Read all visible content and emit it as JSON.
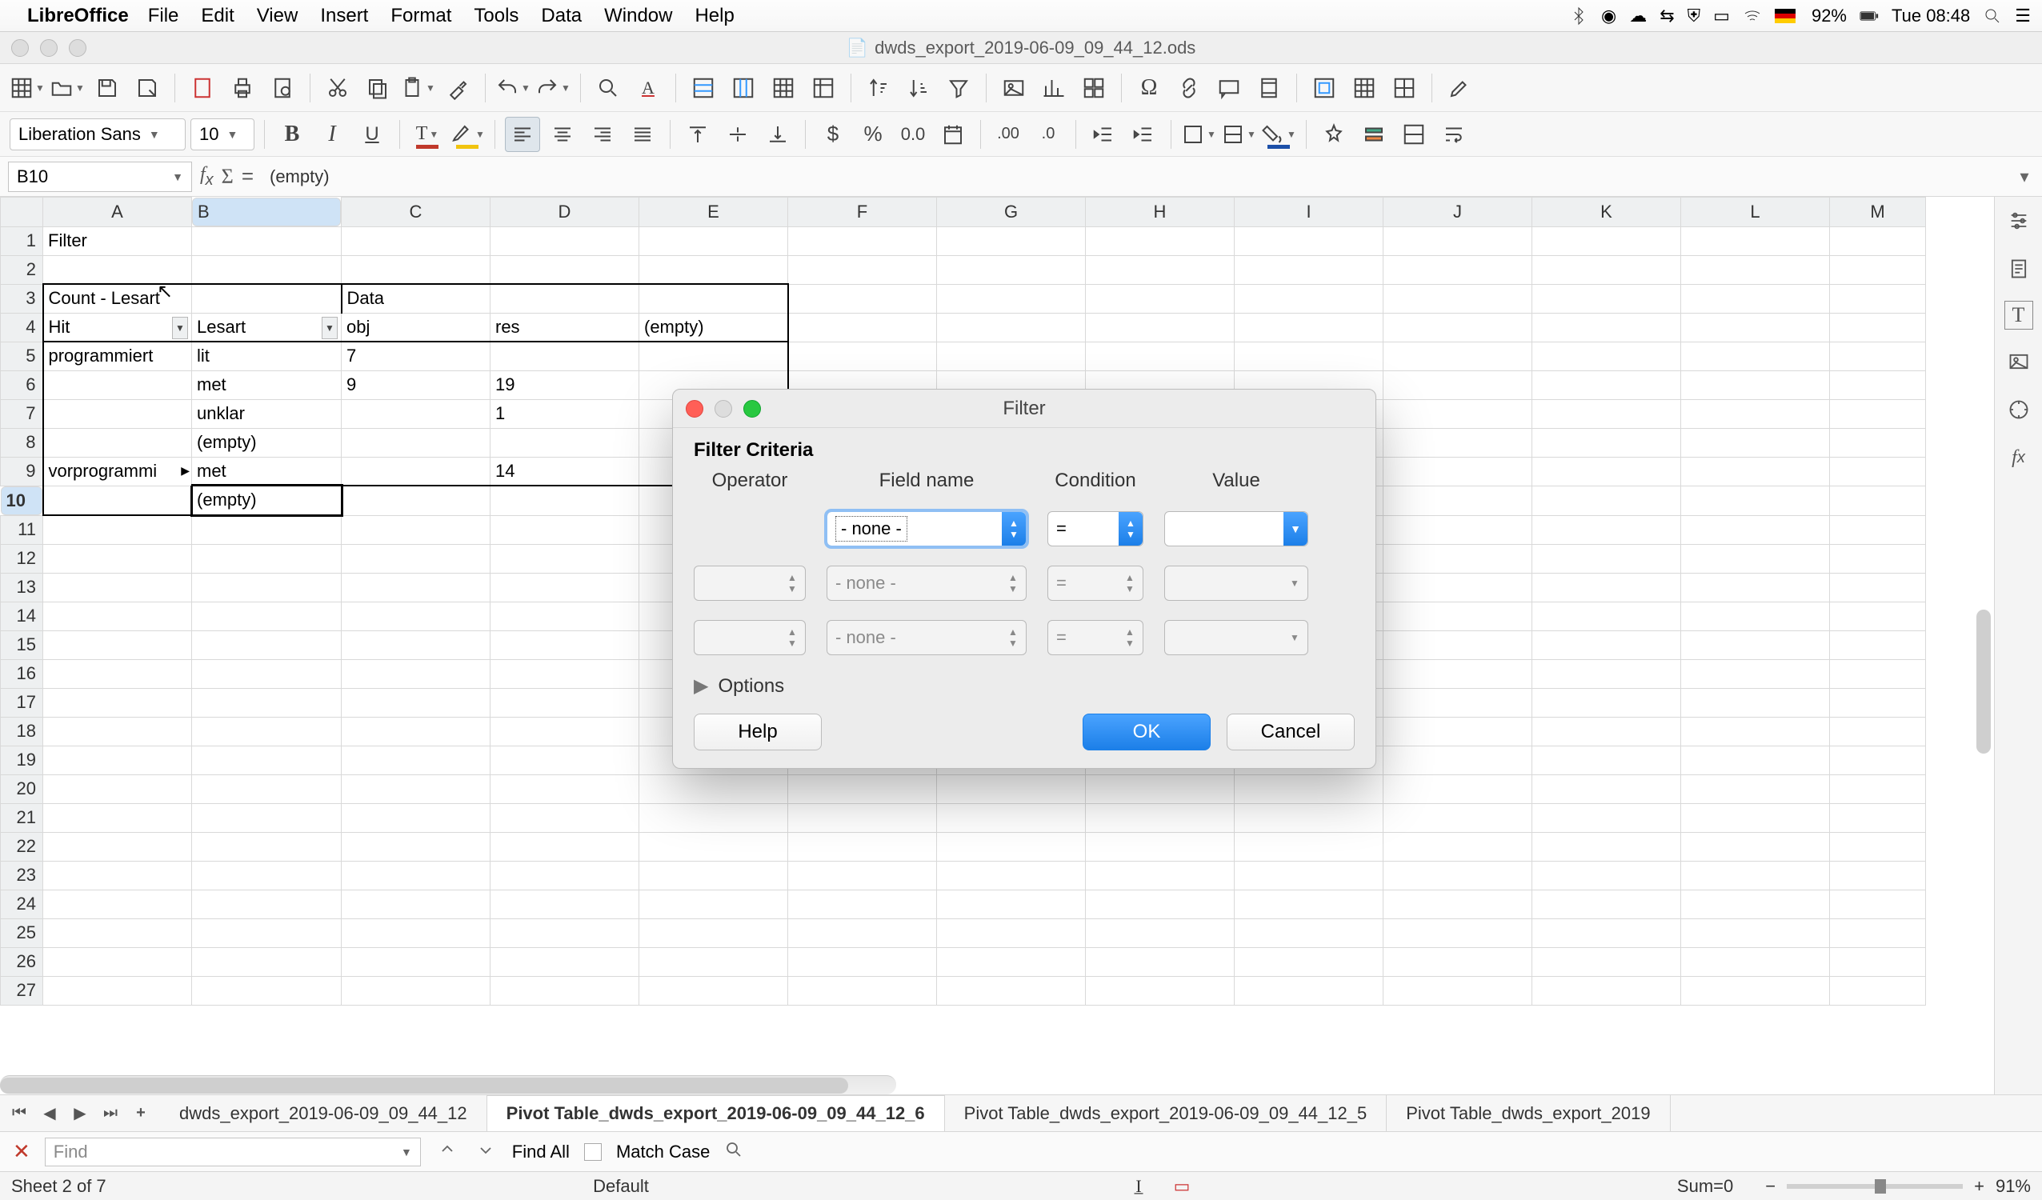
{
  "mac_menu": {
    "app": "LibreOffice",
    "items": [
      "File",
      "Edit",
      "View",
      "Insert",
      "Format",
      "Tools",
      "Data",
      "Window",
      "Help"
    ],
    "battery_pct": "92%",
    "clock": "Tue 08:48"
  },
  "window": {
    "title": "dwds_export_2019-06-09_09_44_12.ods"
  },
  "format_toolbar": {
    "font_name": "Liberation Sans",
    "font_size": "10"
  },
  "formula_bar": {
    "cell_ref": "B10",
    "content": "(empty)"
  },
  "columns": [
    "A",
    "B",
    "C",
    "D",
    "E",
    "F",
    "G",
    "H",
    "I",
    "J",
    "K",
    "L",
    "M"
  ],
  "rows_visible": 27,
  "selected_cell": {
    "col": "B",
    "row": 10
  },
  "cell_data": {
    "A1": "Filter",
    "A3": "Count - Lesart",
    "C3": "Data",
    "A4": "Hit",
    "B4": "Lesart",
    "C4": "obj",
    "D4": "res",
    "E4": "(empty)",
    "A5": "programmiert",
    "B5": "lit",
    "C5": "7",
    "B6": "met",
    "C6": "9",
    "D6": "19",
    "B7": "unklar",
    "D7": "1",
    "B8": "(empty)",
    "A9": "vorprogrammi",
    "B9": "met",
    "D9": "14",
    "B10": "(empty)"
  },
  "sheet_tabs": {
    "tabs": [
      "dwds_export_2019-06-09_09_44_12",
      "Pivot Table_dwds_export_2019-06-09_09_44_12_6",
      "Pivot Table_dwds_export_2019-06-09_09_44_12_5",
      "Pivot Table_dwds_export_2019"
    ],
    "active_index": 1
  },
  "find_bar": {
    "placeholder": "Find",
    "find_all": "Find All",
    "match_case": "Match Case"
  },
  "status_bar": {
    "sheet_info": "Sheet 2 of 7",
    "style": "Default",
    "sum": "Sum=0",
    "zoom": "91%",
    "minus": "−",
    "plus": "+"
  },
  "dialog": {
    "title": "Filter",
    "heading": "Filter Criteria",
    "col_operator": "Operator",
    "col_field": "Field name",
    "col_condition": "Condition",
    "col_value": "Value",
    "rows": [
      {
        "operator": "",
        "field": "- none -",
        "condition": "=",
        "value": "",
        "active": true
      },
      {
        "operator": "",
        "field": "- none -",
        "condition": "=",
        "value": "",
        "active": false
      },
      {
        "operator": "",
        "field": "- none -",
        "condition": "=",
        "value": "",
        "active": false
      }
    ],
    "options_label": "Options",
    "help": "Help",
    "ok": "OK",
    "cancel": "Cancel"
  }
}
